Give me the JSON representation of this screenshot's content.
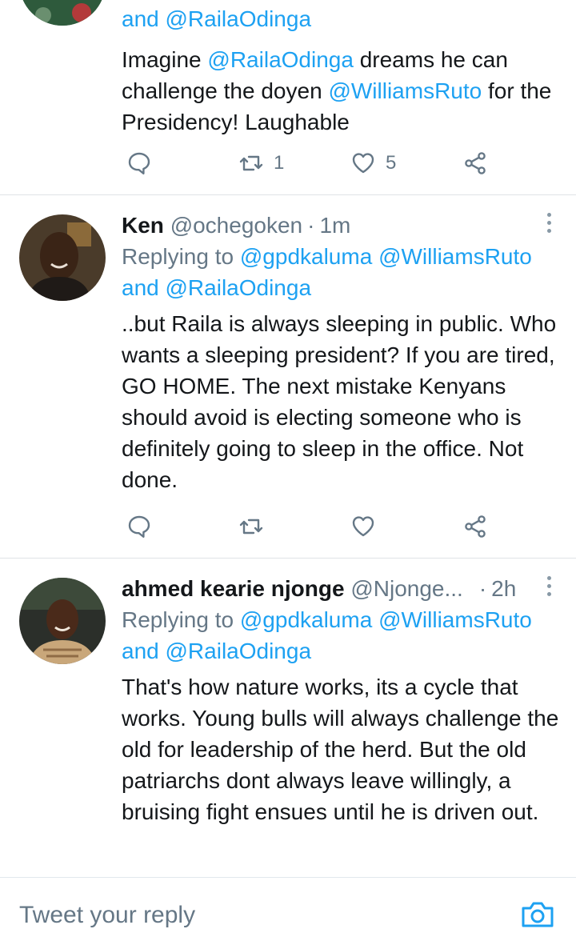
{
  "tweets": [
    {
      "reply_line": "and @RailaOdinga",
      "body_segments": [
        {
          "text": "Imagine ",
          "mention": false
        },
        {
          "text": "@RailaOdinga",
          "mention": true
        },
        {
          "text": "  dreams he can challenge the doyen ",
          "mention": false
        },
        {
          "text": "@WilliamsRuto",
          "mention": true
        },
        {
          "text": "  for the Presidency! Laughable",
          "mention": false
        }
      ],
      "retweet_count": "1",
      "like_count": "5"
    },
    {
      "name": "Ken",
      "handle": "@ochegoken",
      "dot": "·",
      "time": "1m",
      "replying_label": "Replying to",
      "replying_mentions": [
        "@gpdkaluma",
        "@WilliamsRuto"
      ],
      "replying_and": "and",
      "replying_last": "@RailaOdinga",
      "body": "..but Raila is always sleeping in public. Who wants a sleeping president? If you are tired, GO HOME. The next mistake Kenyans should avoid is electing someone who is definitely going to sleep in the office. Not done.",
      "retweet_count": "",
      "like_count": ""
    },
    {
      "name": "ahmed kearie njonge",
      "handle": "@Njonge...",
      "dot": "·",
      "time": "2h",
      "replying_label": "Replying to",
      "replying_mentions": [
        "@gpdkaluma",
        "@WilliamsRuto"
      ],
      "replying_and": "and",
      "replying_last": "@RailaOdinga",
      "body": "That's how nature works, its a cycle that works. Young bulls will always challenge the old for leadership of the herd. But the old patriarchs dont always leave willingly, a bruising fight ensues until he is driven out."
    }
  ],
  "composer": {
    "placeholder": "Tweet your reply",
    "camera_icon": "camera-icon"
  },
  "colors": {
    "accent": "#1da1f2",
    "secondary_text": "#657786",
    "primary_text": "#14171a",
    "divider": "#dfe3e7"
  }
}
